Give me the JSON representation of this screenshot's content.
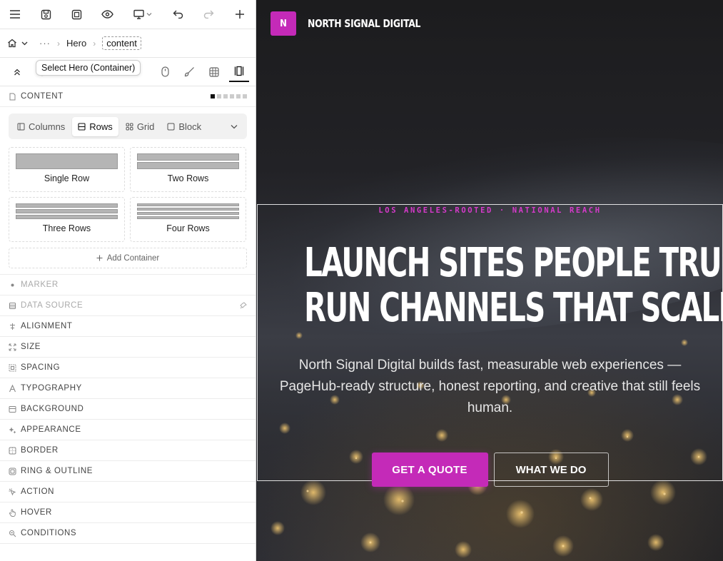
{
  "toolbar": {
    "menu_icon": "menu-icon",
    "save_icon": "save-icon",
    "frame_icon": "frame-icon",
    "preview_icon": "eye-icon",
    "device_icon": "monitor-icon",
    "undo_icon": "undo-icon",
    "redo_icon": "redo-icon",
    "add_icon": "plus-icon"
  },
  "breadcrumb": {
    "ellipsis": "···",
    "items": [
      "Hero",
      "content"
    ]
  },
  "tooltip": "Select Hero (Container)",
  "sections": {
    "content": "CONTENT",
    "marker": "MARKER",
    "data_source": "DATA SOURCE",
    "alignment": "ALIGNMENT",
    "size": "SIZE",
    "spacing": "SPACING",
    "typography": "TYPOGRAPHY",
    "background": "BACKGROUND",
    "appearance": "APPEARANCE",
    "border": "BORDER",
    "ring_outline": "RING & OUTLINE",
    "action": "ACTION",
    "hover": "HOVER",
    "conditions": "CONDITIONS"
  },
  "layout_tabs": [
    "Columns",
    "Rows",
    "Grid",
    "Block"
  ],
  "layout_active": "Rows",
  "row_options": [
    "Single Row",
    "Two Rows",
    "Three Rows",
    "Four Rows"
  ],
  "add_container": "Add Container",
  "site": {
    "logo_letter": "N",
    "brand": "NORTH SIGNAL DIGITAL",
    "eyebrow": "LOS ANGELES-ROOTED · NATIONAL REACH",
    "headline_1": "LAUNCH SITES PEOPLE TRUST.",
    "headline_2": "RUN CHANNELS THAT SCALE.",
    "subtext": "North Signal Digital builds fast, measurable web experiences — PageHub-ready structure, honest reporting, and creative that still feels human.",
    "cta_primary": "GET A QUOTE",
    "cta_secondary": "WHAT WE DO",
    "accent": "#c42ab8"
  }
}
